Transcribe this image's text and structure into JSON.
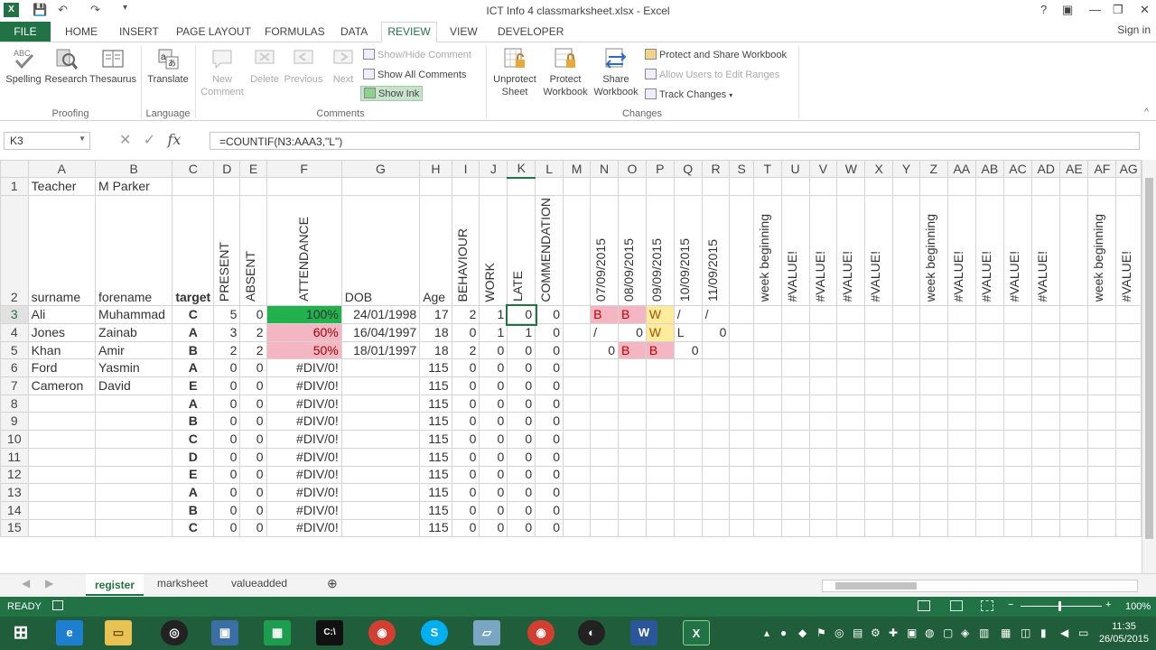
{
  "title": "ICT Info 4 classmarksheet.xlsx - Excel",
  "window_controls": [
    "?",
    "▣",
    "—",
    "❐",
    "✕"
  ],
  "tabs": [
    "FILE",
    "HOME",
    "INSERT",
    "PAGE LAYOUT",
    "FORMULAS",
    "DATA",
    "REVIEW",
    "VIEW",
    "DEVELOPER"
  ],
  "signin": "Sign in",
  "ribbon": {
    "proofing": {
      "group": "Proofing",
      "spelling": "Spelling",
      "research": "Research",
      "thesaurus": "Thesaurus"
    },
    "language": {
      "group": "Language",
      "translate": "Translate"
    },
    "comments": {
      "group": "Comments",
      "new": "New Comment",
      "delete": "Delete",
      "previous": "Previous",
      "next": "Next",
      "show_hide": "Show/Hide Comment",
      "show_all": "Show All Comments",
      "show_ink": "Show Ink"
    },
    "changes": {
      "group": "Changes",
      "unprotect_sheet": "Unprotect Sheet",
      "protect_workbook": "Protect Workbook",
      "share_workbook": "Share Workbook",
      "protect_share": "Protect and Share Workbook",
      "allow_users": "Allow Users to Edit Ranges",
      "track_changes": "Track Changes"
    }
  },
  "namebox": "K3",
  "formula": "=COUNTIF(N3:AAA3,\"L\")",
  "columns": [
    "A",
    "B",
    "C",
    "D",
    "E",
    "F",
    "G",
    "H",
    "I",
    "J",
    "K",
    "L",
    "M",
    "N",
    "O",
    "P",
    "Q",
    "R",
    "S",
    "T",
    "U",
    "V",
    "W",
    "X",
    "Y",
    "Z",
    "AA",
    "AB",
    "AC",
    "AD",
    "AE",
    "AF",
    "AG"
  ],
  "row1": {
    "num": "1",
    "a": "Teacher",
    "b": "M Parker"
  },
  "row2": {
    "num": "2",
    "surname": "surname",
    "forename": "forename",
    "target": "target",
    "present": "PRESENT",
    "absent": "ABSENT",
    "attendance": "ATTENDANCE",
    "dob": "DOB",
    "age": "Age",
    "behaviour": "BEHAVIOUR",
    "work": "WORK",
    "late": "LATE",
    "commendation": "COMMENDATION",
    "d1": "07/09/2015",
    "d2": "08/09/2015",
    "d3": "09/09/2015",
    "d4": "10/09/2015",
    "d5": "11/09/2015",
    "wb": "week beginning",
    "val": "#VALUE!"
  },
  "rows": [
    {
      "n": "3",
      "a": "Ali",
      "b": "Muhammad",
      "c": "C",
      "d": "5",
      "e": "0",
      "f": "100%",
      "g": "24/01/1998",
      "h": "17",
      "i": "2",
      "j": "1",
      "k": "0",
      "l": "0",
      "nn": "B",
      "o": "B",
      "p": "W",
      "q": "/",
      "r": "/"
    },
    {
      "n": "4",
      "a": "Jones",
      "b": "Zainab",
      "c": "A",
      "d": "3",
      "e": "2",
      "f": "60%",
      "g": "16/04/1997",
      "h": "18",
      "i": "0",
      "j": "1",
      "k": "1",
      "l": "0",
      "nn": "/",
      "o": "0",
      "p": "W",
      "q": "L",
      "r": "0"
    },
    {
      "n": "5",
      "a": "Khan",
      "b": "Amir",
      "c": "B",
      "d": "2",
      "e": "2",
      "f": "50%",
      "g": "18/01/1997",
      "h": "18",
      "i": "2",
      "j": "0",
      "k": "0",
      "l": "0",
      "nn": "0",
      "o": "B",
      "p": "B",
      "q": "0",
      "r": ""
    },
    {
      "n": "6",
      "a": "Ford",
      "b": "Yasmin",
      "c": "A",
      "d": "0",
      "e": "0",
      "f": "#DIV/0!",
      "g": "",
      "h": "115",
      "i": "0",
      "j": "0",
      "k": "0",
      "l": "0",
      "nn": "",
      "o": "",
      "p": "",
      "q": "",
      "r": ""
    },
    {
      "n": "7",
      "a": "Cameron",
      "b": "David",
      "c": "E",
      "d": "0",
      "e": "0",
      "f": "#DIV/0!",
      "g": "",
      "h": "115",
      "i": "0",
      "j": "0",
      "k": "0",
      "l": "0",
      "nn": "",
      "o": "",
      "p": "",
      "q": "",
      "r": ""
    },
    {
      "n": "8",
      "a": "",
      "b": "",
      "c": "A",
      "d": "0",
      "e": "0",
      "f": "#DIV/0!",
      "g": "",
      "h": "115",
      "i": "0",
      "j": "0",
      "k": "0",
      "l": "0",
      "nn": "",
      "o": "",
      "p": "",
      "q": "",
      "r": ""
    },
    {
      "n": "9",
      "a": "",
      "b": "",
      "c": "B",
      "d": "0",
      "e": "0",
      "f": "#DIV/0!",
      "g": "",
      "h": "115",
      "i": "0",
      "j": "0",
      "k": "0",
      "l": "0",
      "nn": "",
      "o": "",
      "p": "",
      "q": "",
      "r": ""
    },
    {
      "n": "10",
      "a": "",
      "b": "",
      "c": "C",
      "d": "0",
      "e": "0",
      "f": "#DIV/0!",
      "g": "",
      "h": "115",
      "i": "0",
      "j": "0",
      "k": "0",
      "l": "0",
      "nn": "",
      "o": "",
      "p": "",
      "q": "",
      "r": ""
    },
    {
      "n": "11",
      "a": "",
      "b": "",
      "c": "D",
      "d": "0",
      "e": "0",
      "f": "#DIV/0!",
      "g": "",
      "h": "115",
      "i": "0",
      "j": "0",
      "k": "0",
      "l": "0",
      "nn": "",
      "o": "",
      "p": "",
      "q": "",
      "r": ""
    },
    {
      "n": "12",
      "a": "",
      "b": "",
      "c": "E",
      "d": "0",
      "e": "0",
      "f": "#DIV/0!",
      "g": "",
      "h": "115",
      "i": "0",
      "j": "0",
      "k": "0",
      "l": "0",
      "nn": "",
      "o": "",
      "p": "",
      "q": "",
      "r": ""
    },
    {
      "n": "13",
      "a": "",
      "b": "",
      "c": "A",
      "d": "0",
      "e": "0",
      "f": "#DIV/0!",
      "g": "",
      "h": "115",
      "i": "0",
      "j": "0",
      "k": "0",
      "l": "0",
      "nn": "",
      "o": "",
      "p": "",
      "q": "",
      "r": ""
    },
    {
      "n": "14",
      "a": "",
      "b": "",
      "c": "B",
      "d": "0",
      "e": "0",
      "f": "#DIV/0!",
      "g": "",
      "h": "115",
      "i": "0",
      "j": "0",
      "k": "0",
      "l": "0",
      "nn": "",
      "o": "",
      "p": "",
      "q": "",
      "r": ""
    },
    {
      "n": "15",
      "a": "",
      "b": "",
      "c": "C",
      "d": "0",
      "e": "0",
      "f": "#DIV/0!",
      "g": "",
      "h": "115",
      "i": "0",
      "j": "0",
      "k": "0",
      "l": "0",
      "nn": "",
      "o": "",
      "p": "",
      "q": "",
      "r": ""
    }
  ],
  "sheets": [
    "register",
    "marksheet",
    "valueadded"
  ],
  "status": {
    "ready": "READY",
    "zoom": "100%"
  },
  "clock": {
    "time": "11:35",
    "date": "26/05/2015"
  },
  "colors": {
    "excel_green": "#217346",
    "attendance_ok": "#22b14c",
    "bad_fill": "#f4b6c2",
    "neutral_fill": "#ffeb9c"
  }
}
